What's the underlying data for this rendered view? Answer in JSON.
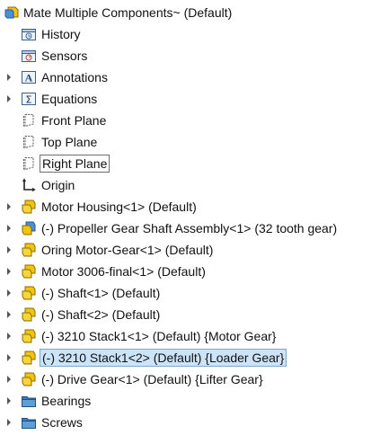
{
  "root": {
    "label": "Mate Multiple Components~  (Default)",
    "icon": "assembly-icon"
  },
  "items": [
    {
      "label": "History",
      "icon": "history-folder-icon",
      "expandable": false,
      "state": "normal"
    },
    {
      "label": "Sensors",
      "icon": "sensors-icon",
      "expandable": false,
      "state": "normal"
    },
    {
      "label": "Annotations",
      "icon": "annotations-icon",
      "expandable": true,
      "state": "normal"
    },
    {
      "label": "Equations",
      "icon": "equations-icon",
      "expandable": true,
      "state": "normal"
    },
    {
      "label": "Front Plane",
      "icon": "plane-icon",
      "expandable": false,
      "state": "normal"
    },
    {
      "label": "Top Plane",
      "icon": "plane-icon",
      "expandable": false,
      "state": "normal"
    },
    {
      "label": "Right Plane",
      "icon": "plane-icon",
      "expandable": false,
      "state": "outlined"
    },
    {
      "label": "Origin",
      "icon": "origin-icon",
      "expandable": false,
      "state": "normal"
    },
    {
      "label": "Motor Housing<1> (Default)",
      "icon": "part-icon",
      "expandable": true,
      "state": "normal"
    },
    {
      "label": "(-) Propeller Gear Shaft Assembly<1> (32 tooth gear)",
      "icon": "subassembly-icon",
      "expandable": true,
      "state": "normal"
    },
    {
      "label": "Oring Motor-Gear<1> (Default)",
      "icon": "part-icon",
      "expandable": true,
      "state": "normal"
    },
    {
      "label": "Motor 3006-final<1> (Default)",
      "icon": "part-icon",
      "expandable": true,
      "state": "normal"
    },
    {
      "label": "(-) Shaft<1> (Default)",
      "icon": "part-icon",
      "expandable": true,
      "state": "normal"
    },
    {
      "label": "(-) Shaft<2> (Default)",
      "icon": "part-icon",
      "expandable": true,
      "state": "normal"
    },
    {
      "label": "(-) 3210 Stack1<1> (Default) {Motor Gear}",
      "icon": "part-icon",
      "expandable": true,
      "state": "normal"
    },
    {
      "label": "(-) 3210 Stack1<2> (Default) {Loader Gear}",
      "icon": "part-icon",
      "expandable": true,
      "state": "selected"
    },
    {
      "label": "(-) Drive Gear<1> (Default) {Lifter Gear}",
      "icon": "part-icon",
      "expandable": true,
      "state": "normal"
    },
    {
      "label": "Bearings",
      "icon": "folder-icon",
      "expandable": true,
      "state": "normal"
    },
    {
      "label": "Screws",
      "icon": "folder-icon",
      "expandable": true,
      "state": "normal"
    }
  ],
  "colors": {
    "selection_bg": "#cce4f7",
    "selection_border": "#7aa7d6",
    "part_yellow": "#f2c40f",
    "folder_blue": "#3c7fc0"
  }
}
